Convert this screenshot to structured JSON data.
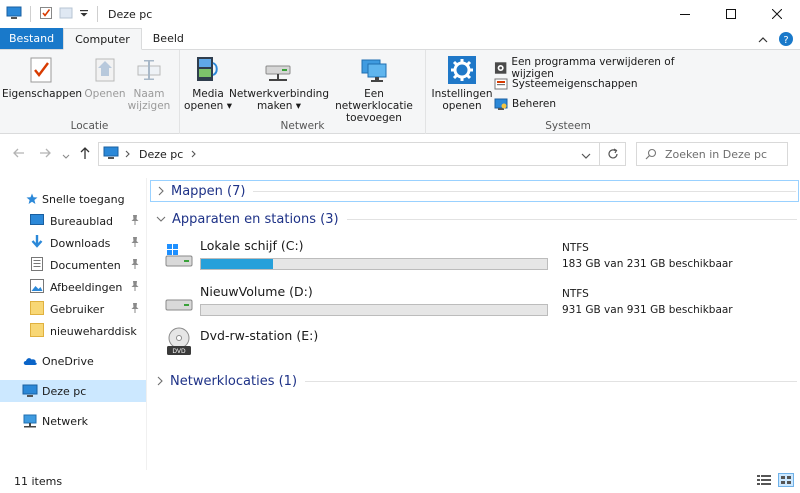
{
  "window": {
    "title": "Deze pc"
  },
  "tabs": [
    {
      "label": "Bestand"
    },
    {
      "label": "Computer"
    },
    {
      "label": "Beeld"
    }
  ],
  "ribbon": {
    "locatie": {
      "label": "Locatie",
      "eigenschappen": "Eigenschappen",
      "openen": "Openen",
      "naam_1": "Naam",
      "naam_2": "wijzigen"
    },
    "netwerk": {
      "label": "Netwerk",
      "media_1": "Media",
      "media_2": "openen",
      "netverb_1": "Netwerkverbinding",
      "netverb_2": "maken",
      "netloc_1": "Een netwerklocatie",
      "netloc_2": "toevoegen"
    },
    "systeem": {
      "label": "Systeem",
      "instellingen_1": "Instellingen",
      "instellingen_2": "openen",
      "verwijderen": "Een programma verwijderen of wijzigen",
      "eigenschappen": "Systeemeigenschappen",
      "beheren": "Beheren"
    }
  },
  "address": {
    "crumb": "Deze pc",
    "search_placeholder": "Zoeken in Deze pc"
  },
  "nav": {
    "quick_access": "Snelle toegang",
    "quick_items": [
      {
        "label": "Bureaublad"
      },
      {
        "label": "Downloads"
      },
      {
        "label": "Documenten"
      },
      {
        "label": "Afbeeldingen"
      },
      {
        "label": "Gebruiker"
      },
      {
        "label": "nieuweharddisk"
      }
    ],
    "onedrive": "OneDrive",
    "this_pc": "Deze pc",
    "network": "Netwerk"
  },
  "content": {
    "groups": {
      "mappen": "Mappen (7)",
      "apparaten": "Apparaten en stations (3)",
      "netwerk": "Netwerklocaties (1)"
    },
    "drives": [
      {
        "name": "Lokale schijf (C:)",
        "fs": "NTFS",
        "free": "183 GB van 231 GB beschikbaar",
        "used_fraction": 0.208
      },
      {
        "name": "NieuwVolume (D:)",
        "fs": "NTFS",
        "free": "931 GB van 931 GB beschikbaar",
        "used_fraction": 0.0
      },
      {
        "name": "Dvd-rw-station (E:)"
      }
    ]
  },
  "status": {
    "items": "11 items"
  },
  "colors": {
    "accent": "#1979ca",
    "bar_fill": "#26a0da",
    "selected": "#cce8ff",
    "group_header": "#1e3287"
  }
}
